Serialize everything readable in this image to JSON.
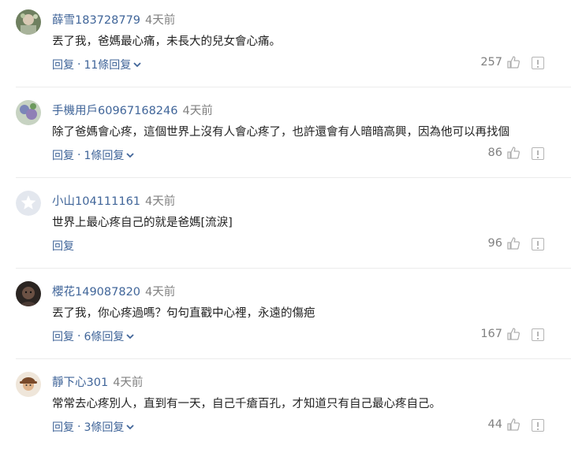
{
  "comments": [
    {
      "username": "薛雪183728779",
      "time": "4天前",
      "text": "丟了我，爸媽最心痛，未長大的兒女會心痛。",
      "reply_label": "回复",
      "sep": "·",
      "replies_label": "11條回复",
      "likes": "257",
      "avatar_color": "#8a9a78"
    },
    {
      "username": "手機用戶60967168246",
      "time": "4天前",
      "text": "除了爸媽會心疼，這個世界上沒有人會心疼了，也許還會有人暗暗高興，因為他可以再找個",
      "reply_label": "回复",
      "sep": "·",
      "replies_label": "1條回复",
      "likes": "86",
      "avatar_color": "#7b86b8"
    },
    {
      "username": "小山104111161",
      "time": "4天前",
      "text": "世界上最心疼自己的就是爸媽[流淚]",
      "reply_label": "回复",
      "likes": "96",
      "avatar_color": "#e4e8ee"
    },
    {
      "username": "櫻花149087820",
      "time": "4天前",
      "text": "丟了我，你心疼過嗎？句句直戳中心裡，永遠的傷疤",
      "reply_label": "回复",
      "sep": "·",
      "replies_label": "6條回复",
      "likes": "167",
      "avatar_color": "#3a2e2a"
    },
    {
      "username": "靜下心301",
      "time": "4天前",
      "text": "常常去心疼別人，直到有一天，自己千瘡百孔，才知道只有自己最心疼自己。",
      "reply_label": "回复",
      "sep": "·",
      "replies_label": "3條回复",
      "likes": "44",
      "avatar_color": "#c9a27c"
    }
  ]
}
